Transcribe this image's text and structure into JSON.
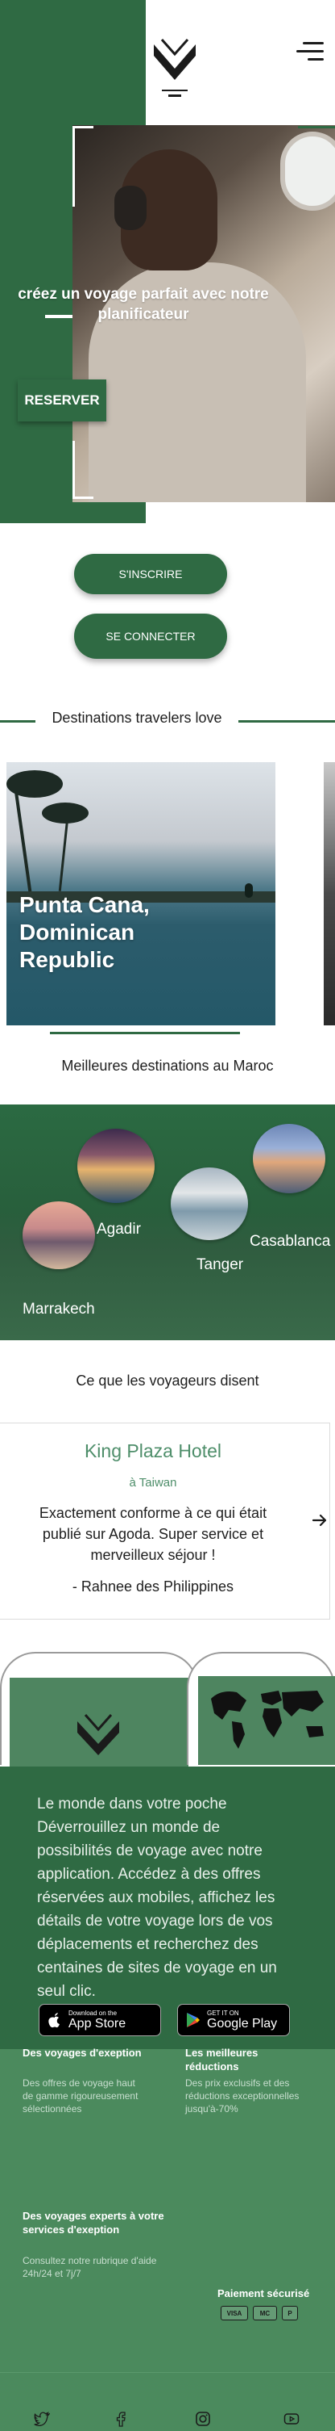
{
  "brand": {
    "logo_icon": "chevron-wings-logo-icon",
    "colors": {
      "primary": "#2f6a43",
      "footer": "#4b8a5d",
      "accent_text": "#4e8e6a"
    }
  },
  "header": {
    "menu_icon": "hamburger-menu-icon"
  },
  "hero": {
    "title": "créez un voyage parfait avec notre planificateur",
    "reserve_label": "RESERVER"
  },
  "auth": {
    "signup_label": "S'INSCRIRE",
    "login_label": "SE CONNECTER"
  },
  "destinations": {
    "heading": "Destinations travelers love",
    "cards": [
      {
        "title": "Punta Cana, Dominican Republic"
      }
    ]
  },
  "maroc": {
    "heading": "Meilleures destinations au Maroc",
    "cities": [
      {
        "name": "Agadir"
      },
      {
        "name": "Tanger"
      },
      {
        "name": "Casablanca"
      },
      {
        "name": "Marrakech"
      }
    ]
  },
  "reviews": {
    "heading": "Ce que les voyageurs disent",
    "hotel": "King Plaza Hotel",
    "location": "à Taiwan",
    "text": "Exactement conforme à ce qui était publié sur Agoda. Super service et merveilleux séjour !",
    "author": "- Rahnee des Philippines",
    "next_icon": "arrow-right-icon"
  },
  "app": {
    "text": "Le monde dans votre poche Déverrouillez un monde de possibilités de voyage avec notre application. Accédez à des offres réservées aux mobiles, affichez les détails de votre voyage lors de vos déplacements et recherchez des centaines de sites de voyage en un seul clic.",
    "appstore_small": "Download on the",
    "appstore_big": "App Store",
    "googleplay_small": "GET IT ON",
    "googleplay_big": "Google Play"
  },
  "footer": {
    "col1_title": "Des voyages d'exeption",
    "col1_text": "Des offres de voyage haut de gamme rigoureusement sélectionnées",
    "col2_title": "Les meilleures réductions",
    "col2_text": "Des prix exclusifs et des réductions exceptionnelles jusqu'à-70%",
    "col3_title": "Des voyages experts à votre services d'exeption",
    "col3_text": "Consultez notre rubrique d'aide 24h/24 et 7j/7",
    "payment_title": "Paiement sécurisé",
    "payment_methods": [
      "VISA",
      "MC",
      "P"
    ]
  },
  "social": [
    "twitter-icon",
    "facebook-icon",
    "instagram-icon",
    "youtube-icon"
  ]
}
